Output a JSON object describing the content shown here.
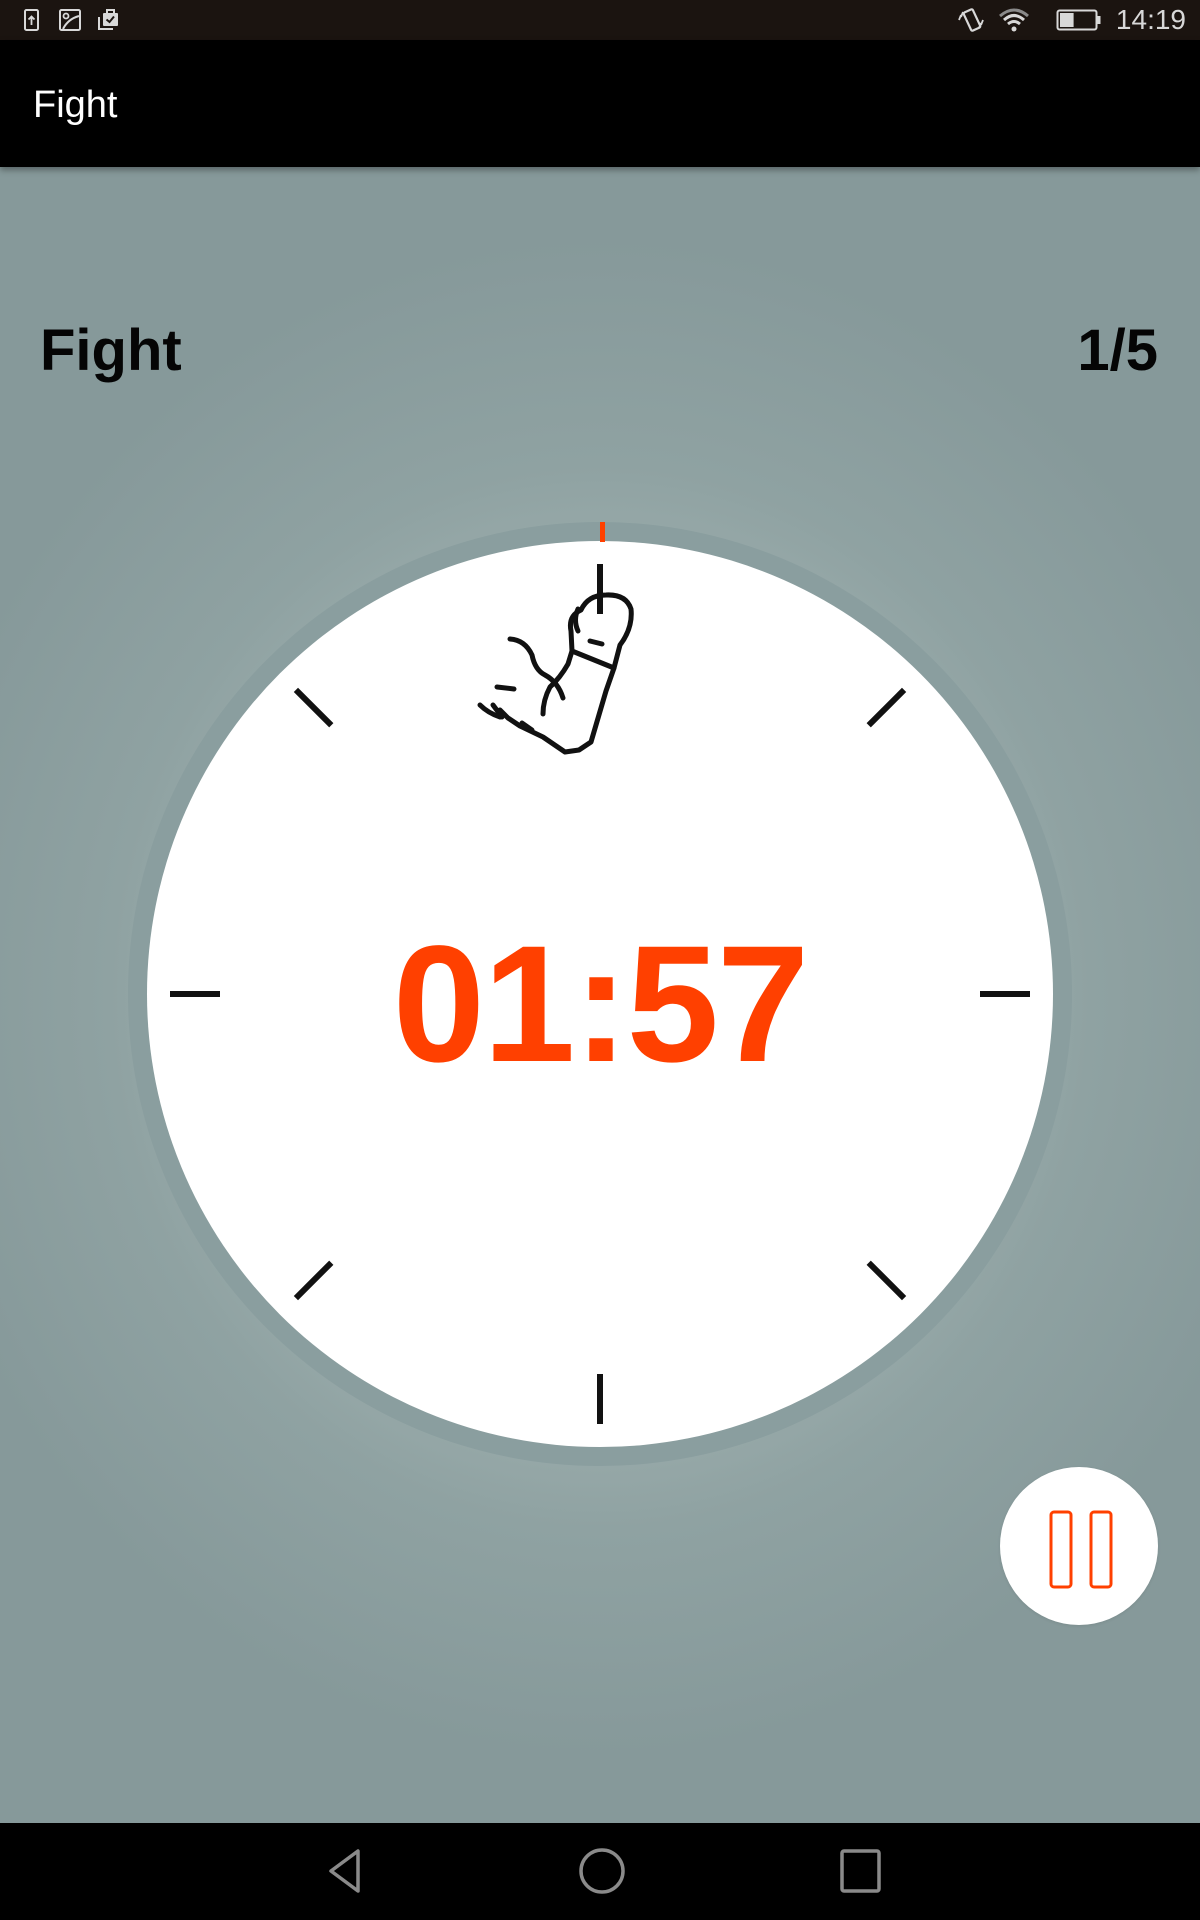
{
  "status_bar": {
    "left_icons": [
      "upload-notification-icon",
      "image-notification-icon",
      "clipboard-check-icon"
    ],
    "right_icons": [
      "vibrate-icon",
      "wifi-icon",
      "battery-icon"
    ],
    "battery_level": 0.4,
    "time": "14:19"
  },
  "app_bar": {
    "title": "Fight"
  },
  "main": {
    "phase_label": "Fight",
    "round_counter": "1/5",
    "round_current": 1,
    "round_total": 5,
    "timer": "01:57",
    "phase_icon": "boxing-arm-icon",
    "progress_marker_fraction": 0.0
  },
  "controls": {
    "pause_button_icon": "pause-icon"
  },
  "nav_bar": {
    "buttons": [
      "back-icon",
      "home-icon",
      "recents-icon"
    ]
  },
  "colors": {
    "accent": "#ff4000",
    "app_bar": "#000000",
    "status_bar": "#1b1410",
    "clock_ring": "#8a9e9f",
    "clock_face": "#ffffff",
    "tick": "#111111"
  }
}
